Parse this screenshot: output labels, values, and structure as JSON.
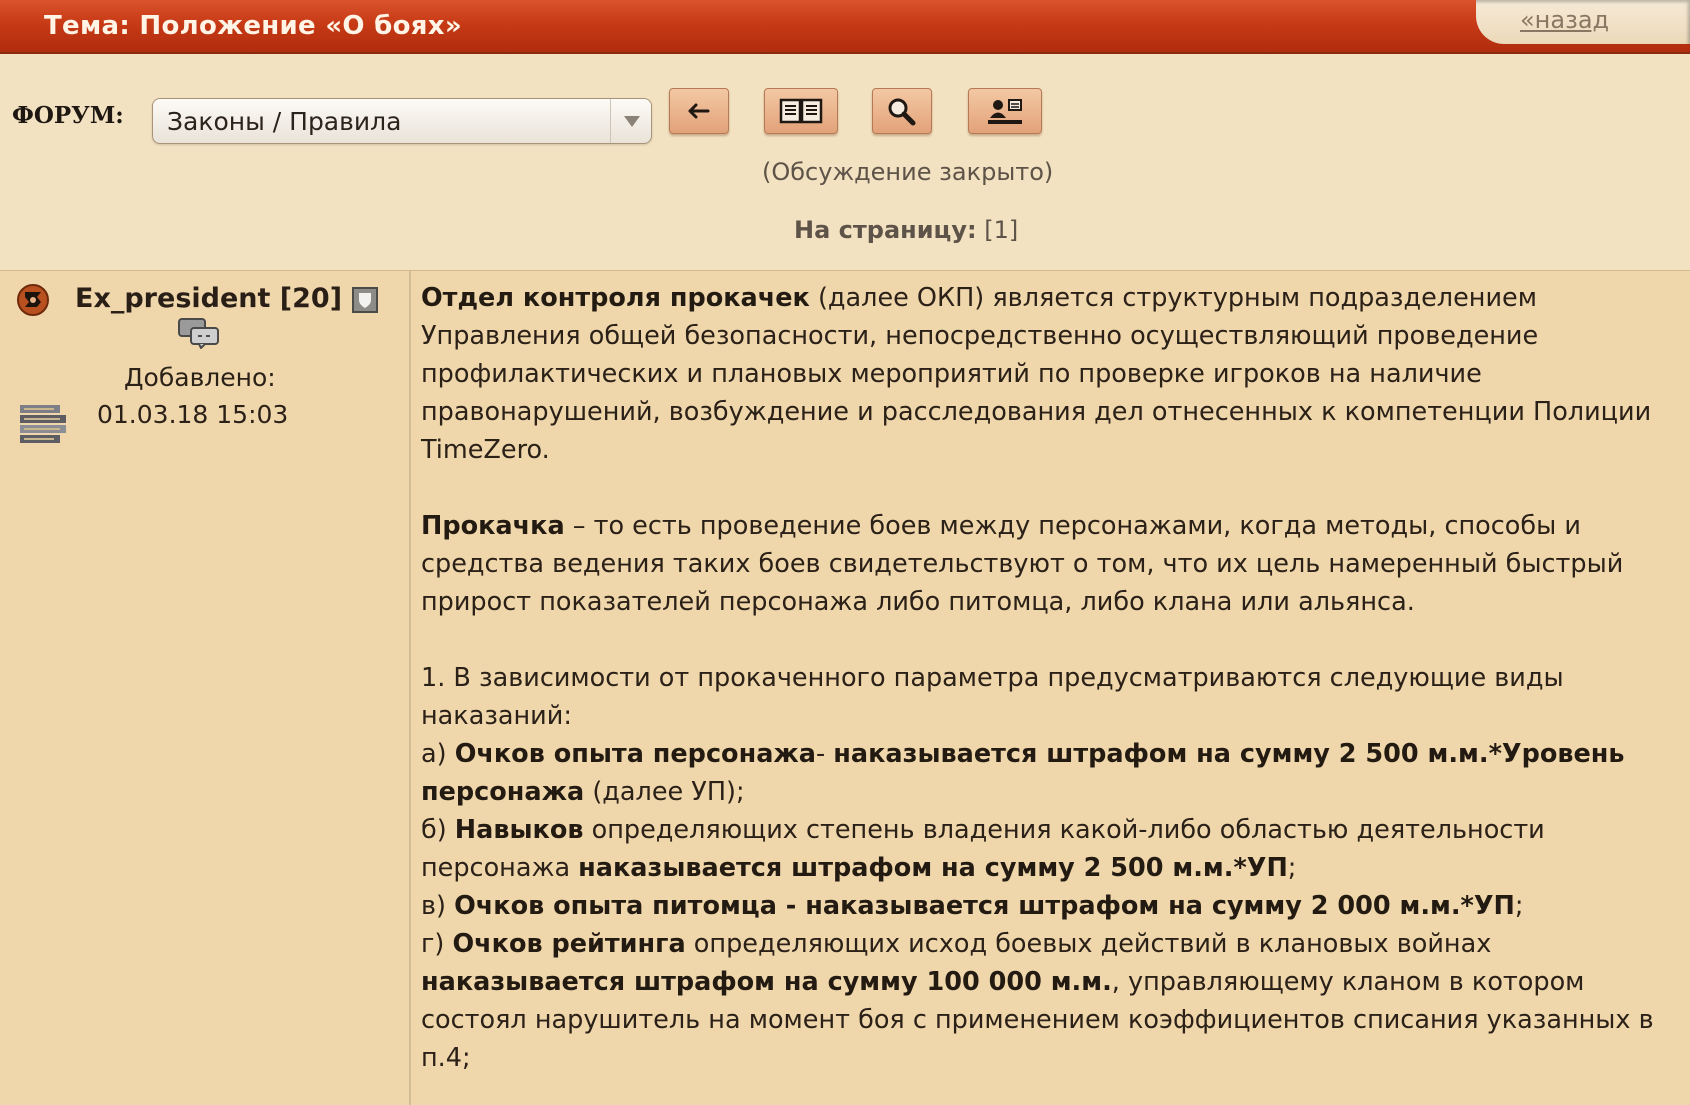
{
  "header": {
    "title": "Тема: Положение «О боях»",
    "back_link": "«назад"
  },
  "toolbar": {
    "forum_label": "ФОРУМ:",
    "forum_select_value": "Законы / Правила",
    "buttons": [
      "back-arrow-icon",
      "book-icon",
      "search-icon",
      "profile-card-icon"
    ],
    "closed_note": "(Обсуждение закрыто)",
    "pager_label": "На страницу:",
    "pager_pages": "[1]"
  },
  "post": {
    "author": "Ex_president [20]",
    "added_label": "Добавлено:",
    "added_date": "01.03.18 15:03",
    "p1": {
      "b1": "Отдел контроля прокачек",
      "t1": " (далее ОКП) является структурным подразделением Управления общей безопасности, непосредственно осуществляющий проведение профилактических и плановых мероприятий по проверке игроков на наличие правонарушений, возбуждение и расследования дел отнесенных к компетенции Полиции TimeZero."
    },
    "p2": {
      "b1": "Прокачка",
      "t1": " – то есть проведение боев между персонажами, когда методы, способы и средства ведения таких боев свидетельствуют о том, что их цель намеренный быстрый прирост показателей персонажа либо питомца, либо клана или альянса."
    },
    "p3": {
      "intro": "1. В зависимости от прокаченного параметра предусматриваются следующие виды наказаний:",
      "a_pre": "а) ",
      "a_b1": "Очков опыта персонажа",
      "a_t1": "- ",
      "a_b2": "наказывается штрафом на сумму 2 500 м.м.*Уровень персонажа",
      "a_t2": " (далее УП);",
      "b_pre": "б) ",
      "b_b1": "Навыков",
      "b_t1": " определяющих степень владения какой-либо областью деятельности персонажа ",
      "b_b2": "наказывается штрафом на сумму 2 500 м.м.*УП",
      "b_t2": ";",
      "c_pre": "в) ",
      "c_b1": "Очков опыта питомца - наказывается штрафом на сумму 2 000 м.м.*УП",
      "c_t1": ";",
      "d_pre": "г) ",
      "d_b1": "Очков рейтинга",
      "d_t1": " определяющих исход боевых действий в клановых войнах ",
      "d_b2": "наказывается штрафом на сумму 100 000 м.м.",
      "d_t2": ", управляющему кланом в котором состоял нарушитель на момент боя с применением коэффициентов списания указанных в п.4;"
    }
  }
}
